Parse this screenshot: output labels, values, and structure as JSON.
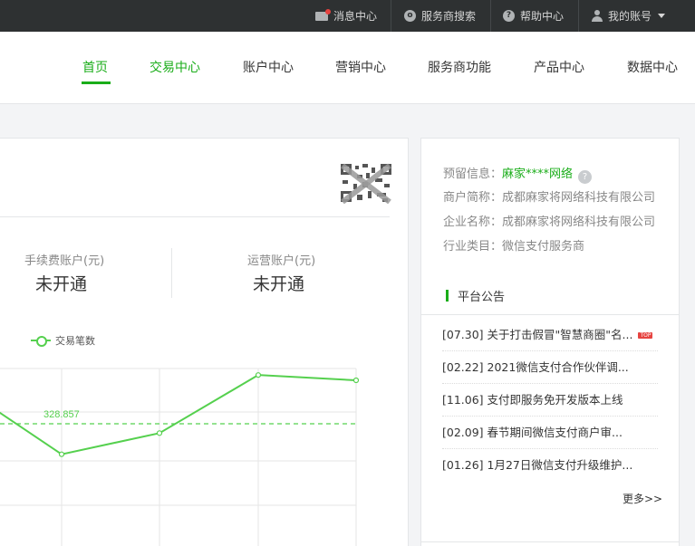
{
  "topbar": {
    "messages": "消息中心",
    "provider_search": "服务商搜索",
    "help": "帮助中心",
    "account": "我的账号"
  },
  "nav": {
    "items": [
      "首页",
      "交易中心",
      "账户中心",
      "营销中心",
      "服务商功能",
      "产品中心",
      "数据中心"
    ],
    "active": "首页"
  },
  "accounts": {
    "fee_label": "手续费账户(元)",
    "fee_value": "未开通",
    "ops_label": "运营账户(元)",
    "ops_value": "未开通"
  },
  "chart_data": {
    "type": "line",
    "series": [
      {
        "name": "交易笔数",
        "values": [
          345,
          300,
          320,
          375,
          370
        ]
      }
    ],
    "average_line": {
      "value": 328.857,
      "label": "328.857"
    },
    "colors": {
      "line": "#55d04e"
    }
  },
  "merchant": {
    "reserved_label": "预留信息：",
    "reserved_value": "麻家****网络",
    "short_name": "商户简称：成都麻家将网络科技有限公司",
    "company_name": "企业名称：成都麻家将网络科技有限公司",
    "industry": "行业类目：微信支付服务商",
    "help_icon": "?"
  },
  "notices": {
    "title": "平台公告",
    "items": [
      "[07.30] 关于打击假冒\"智慧商圈\"名...",
      "[02.22] 2021微信支付合作伙伴调...",
      "[11.06] 支付即服务免开发版本上线",
      "[02.09] 春节期间微信支付商户审...",
      "[01.26] 1月27日微信支付升级维护..."
    ],
    "top_badge": "TOP",
    "more": "更多>>"
  },
  "colors": {
    "accent": "#1aad19",
    "topbar": "#2e3132",
    "badge": "#e64340"
  }
}
